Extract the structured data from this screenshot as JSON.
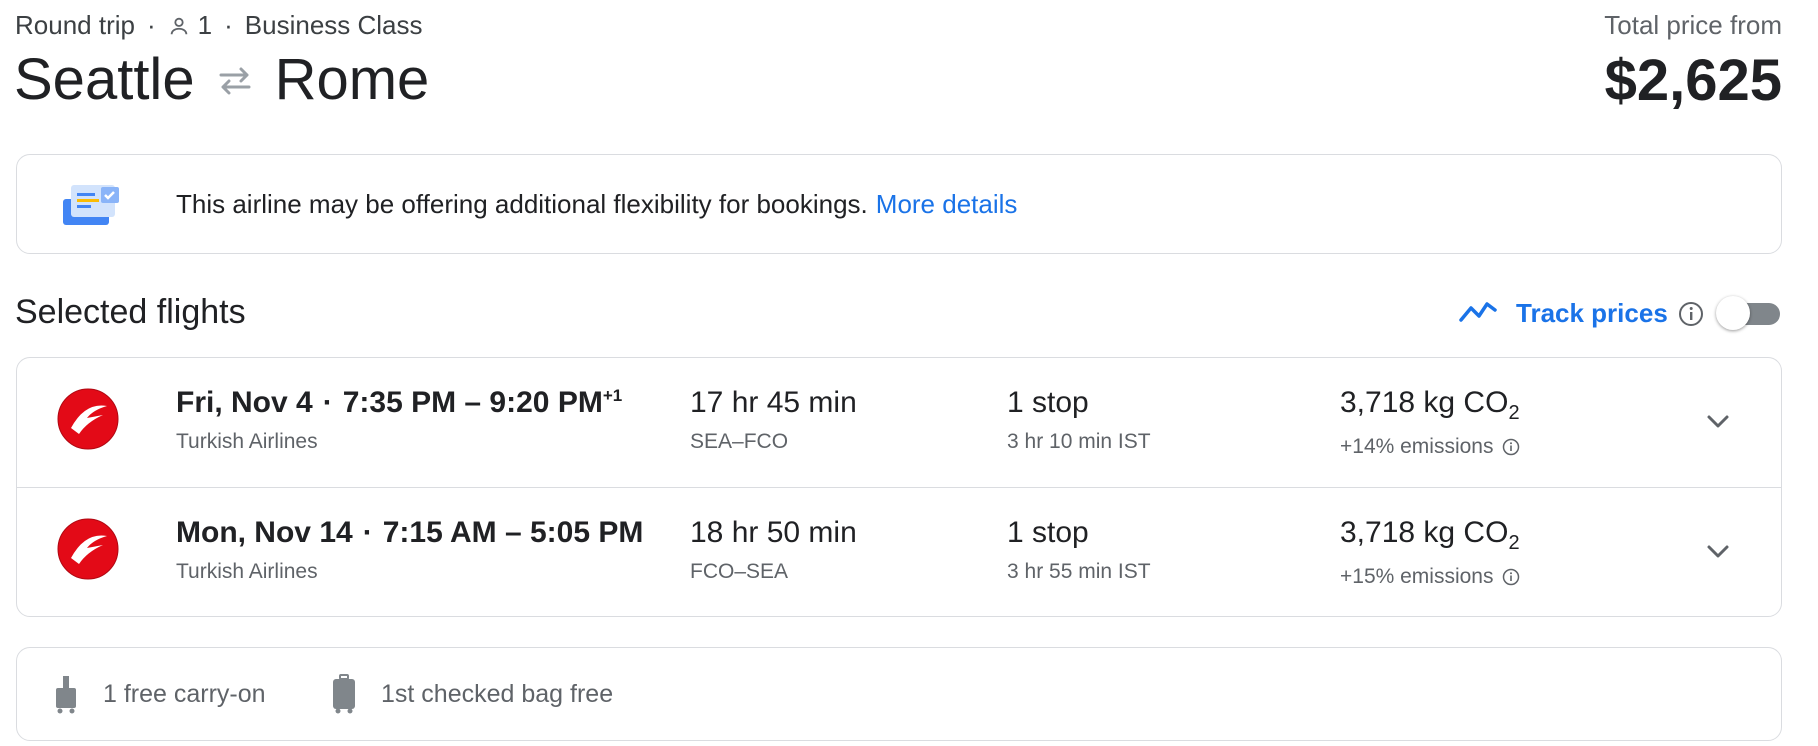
{
  "header": {
    "trip_type": "Round trip",
    "passengers": "1",
    "cabin": "Business Class",
    "origin": "Seattle",
    "destination": "Rome",
    "price_label": "Total price from",
    "price": "$2,625"
  },
  "banner": {
    "text": "This airline may be offering additional flexibility for bookings.",
    "link": "More details"
  },
  "selected": {
    "title": "Selected flights",
    "track_label": "Track prices",
    "track_enabled": false
  },
  "flights": [
    {
      "date": "Fri, Nov 4",
      "time_range": "7:35 PM – 9:20 PM",
      "day_offset": "+1",
      "airline": "Turkish Airlines",
      "duration": "17 hr 45 min",
      "route": "SEA–FCO",
      "stops": "1 stop",
      "layover": "3 hr 10 min IST",
      "co2": "3,718 kg CO",
      "co2_sub": "2",
      "emissions": "+14% emissions"
    },
    {
      "date": "Mon, Nov 14",
      "time_range": "7:15 AM – 5:05 PM",
      "day_offset": "",
      "airline": "Turkish Airlines",
      "duration": "18 hr 50 min",
      "route": "FCO–SEA",
      "stops": "1 stop",
      "layover": "3 hr 55 min IST",
      "co2": "3,718 kg CO",
      "co2_sub": "2",
      "emissions": "+15% emissions"
    }
  ],
  "baggage": {
    "carry_on": "1 free carry-on",
    "checked": "1st checked bag free"
  },
  "colors": {
    "accent": "#1a73e8",
    "text": "#202124",
    "muted": "#5f6368",
    "border": "#dadce0",
    "airline_red": "#e30a17"
  },
  "icons": [
    "person-icon",
    "swap-arrows-icon",
    "flexible-booking-icon",
    "trend-line-icon",
    "info-icon",
    "turkish-airlines-logo",
    "chevron-down-icon",
    "carry-on-bag-icon",
    "checked-bag-icon"
  ]
}
